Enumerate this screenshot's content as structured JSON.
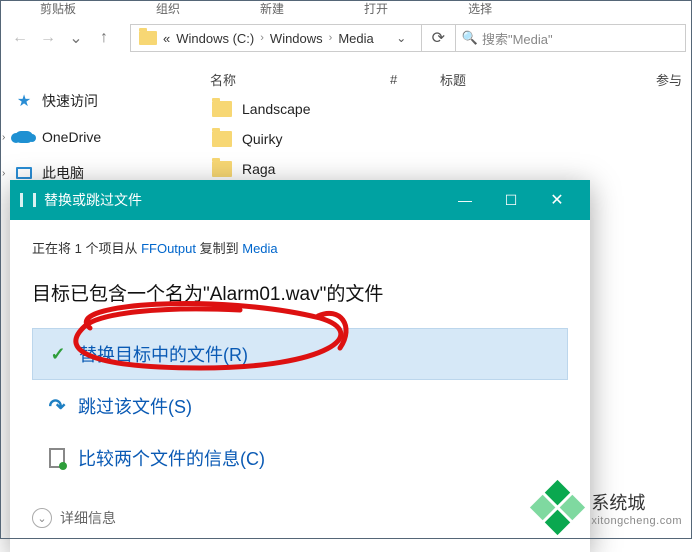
{
  "ribbon": {
    "tabs": [
      "剪贴板",
      "组织",
      "新建",
      "打开",
      "选择"
    ]
  },
  "nav": {
    "back": "←",
    "forward": "→",
    "up": "↑"
  },
  "breadcrumb": {
    "prefix": "«",
    "parts": [
      "Windows (C:)",
      "Windows",
      "Media"
    ],
    "dropdown": "⌄",
    "refresh": "⟳"
  },
  "search": {
    "placeholder": "搜索\"Media\""
  },
  "columns": {
    "name": "名称",
    "hash": "#",
    "title": "标题",
    "participating": "参与"
  },
  "leftnav": {
    "quick": "快速访问",
    "onedrive": "OneDrive",
    "thispc": "此电脑"
  },
  "files": {
    "items": [
      "Landscape",
      "Quirky",
      "Raga"
    ]
  },
  "dialog": {
    "title": "替换或跳过文件",
    "copy_prefix": "正在将 1 个项目从 ",
    "copy_source": "FFOutput",
    "copy_mid": " 复制到 ",
    "copy_dest": "Media",
    "msg_pre": "目标已包含一个名为\"",
    "msg_file": "Alarm01.wav",
    "msg_post": "\"的文件",
    "opt_replace": "替换目标中的文件(R)",
    "opt_skip": "跳过该文件(S)",
    "opt_compare": "比较两个文件的信息(C)",
    "details": "详细信息",
    "min": "—",
    "max": "☐",
    "close": "✕"
  },
  "watermark": {
    "brand": "系统城",
    "url": "xitongcheng.com"
  }
}
